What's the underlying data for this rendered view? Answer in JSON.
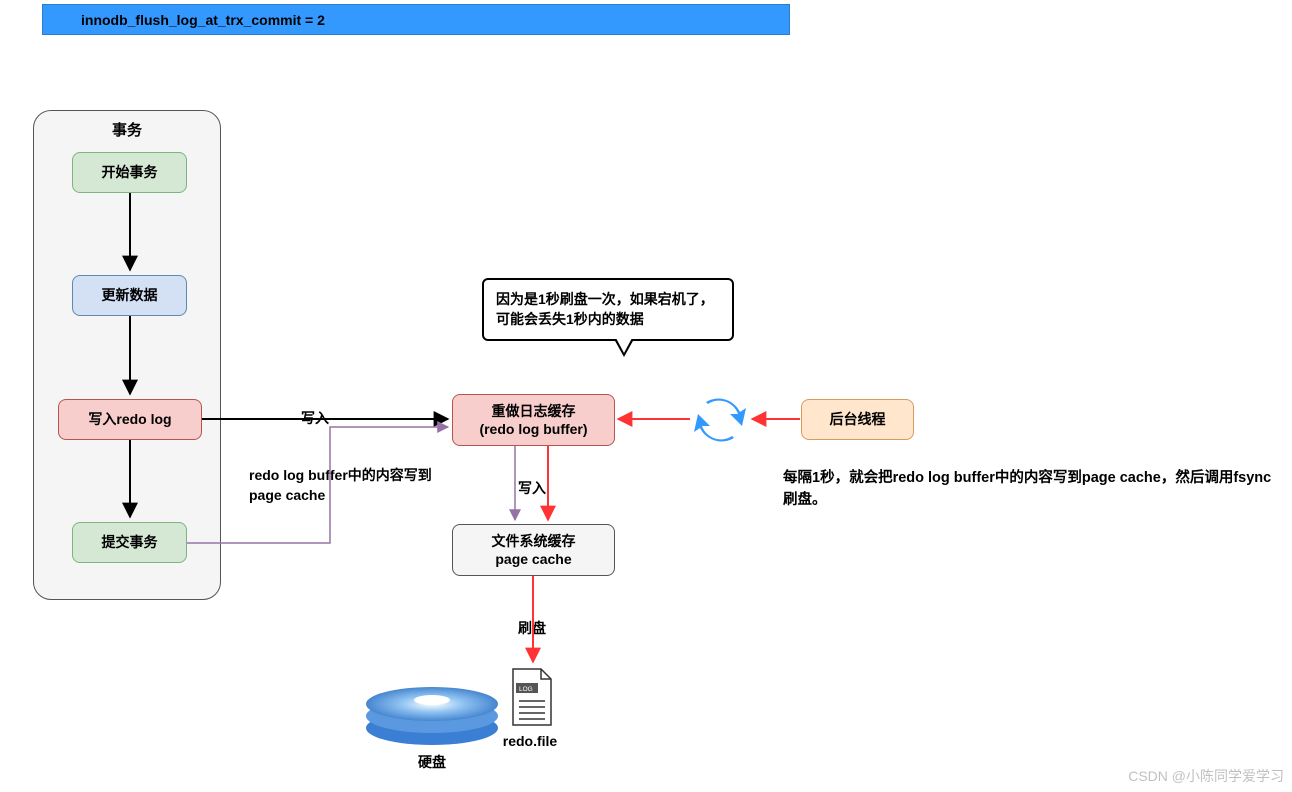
{
  "title": "innodb_flush_log_at_trx_commit = 2",
  "tx": {
    "title": "事务",
    "start": "开始事务",
    "update": "更新数据",
    "writeRedo": "写入redo log",
    "commit": "提交事务"
  },
  "speech": "因为是1秒刷盘一次，如果宕机了，可能会丢失1秒内的数据",
  "redoBuffer": {
    "line1": "重做日志缓存",
    "line2": "(redo log buffer)"
  },
  "pageCache": {
    "line1": "文件系统缓存",
    "line2": "page cache"
  },
  "bgThread": "后台线程",
  "labels": {
    "write1": "写入",
    "bufferNote": "redo log buffer中的内容写到page cache",
    "write2": "写入",
    "flush": "刷盘",
    "disk": "硬盘",
    "redoFile": "redo.file"
  },
  "bgDesc": "每隔1秒，就会把redo log buffer中的内容写到page cache，然后调用fsync刷盘。",
  "watermark": "CSDN @小陈同学爱学习",
  "colors": {
    "blue": "#3399ff",
    "red": "#ff3333",
    "purple": "#9673a6",
    "black": "#000000"
  }
}
